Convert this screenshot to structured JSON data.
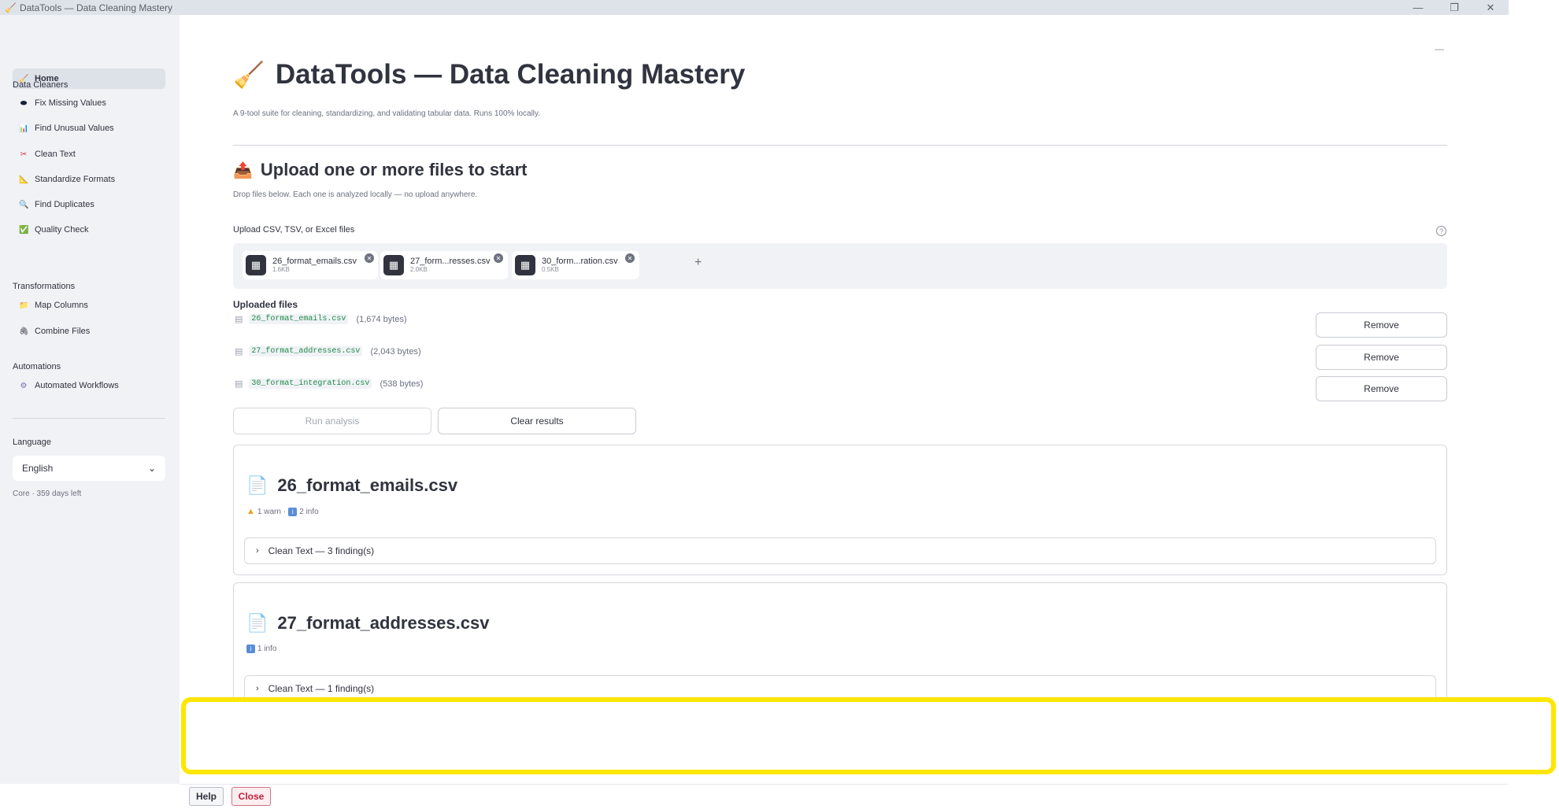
{
  "window": {
    "title": "DataTools — Data Cleaning Mastery",
    "icon": "broom-icon",
    "controls": {
      "minimize": "—",
      "restore": "❐",
      "close": "✕"
    }
  },
  "sidebar": {
    "home": {
      "label": "Home",
      "icon": "🧹"
    },
    "sections": [
      {
        "title": "Data Cleaners",
        "items": [
          {
            "label": "Fix Missing Values",
            "icon": "⬬"
          },
          {
            "label": "Find Unusual Values",
            "icon": "📊"
          },
          {
            "label": "Clean Text",
            "icon": "✂"
          },
          {
            "label": "Standardize Formats",
            "icon": "📐"
          },
          {
            "label": "Find Duplicates",
            "icon": "🔍"
          },
          {
            "label": "Quality Check",
            "icon": "✅"
          }
        ]
      },
      {
        "title": "Transformations",
        "items": [
          {
            "label": "Map Columns",
            "icon": "📁"
          },
          {
            "label": "Combine Files",
            "icon": "🖇"
          }
        ]
      },
      {
        "title": "Automations",
        "items": [
          {
            "label": "Automated Workflows",
            "icon": "⚙"
          }
        ]
      }
    ],
    "language_label": "Language",
    "language_value": "English",
    "license_text": "Core · 359 days left"
  },
  "main": {
    "title_icon": "🧹",
    "title": "DataTools — Data Cleaning Mastery",
    "subtitle": "A 9-tool suite for cleaning, standardizing, and validating tabular data. Runs 100% locally.",
    "upload_heading_icon": "📤",
    "upload_heading": "Upload one or more files to start",
    "upload_hint": "Drop files below. Each one is analyzed locally — no upload anywhere.",
    "uploader_label": "Upload CSV, TSV, or Excel files",
    "chips": [
      {
        "name": "26_format_emails.csv",
        "size": "1.6KB"
      },
      {
        "name": "27_form...resses.csv",
        "size": "2.0KB"
      },
      {
        "name": "30_form...ration.csv",
        "size": "0.5KB"
      }
    ],
    "add_more": "+",
    "uploaded_heading": "Uploaded files",
    "files": [
      {
        "name": "26_format_emails.csv",
        "bytes": "(1,674 bytes)",
        "remove": "Remove"
      },
      {
        "name": "27_format_addresses.csv",
        "bytes": "(2,043 bytes)",
        "remove": "Remove"
      },
      {
        "name": "30_format_integration.csv",
        "bytes": "(538 bytes)",
        "remove": "Remove"
      }
    ],
    "run_button": "Run analysis",
    "clear_button": "Clear results",
    "results": [
      {
        "file": "26_format_emails.csv",
        "warn": "1 warn",
        "sep": "·",
        "info": "2 info",
        "expander": "Clean Text — 3 finding(s)"
      },
      {
        "file": "27_format_addresses.csv",
        "info": "1 info",
        "expander": "Clean Text — 1 finding(s)"
      }
    ]
  },
  "bottom": {
    "help": "Help",
    "close": "Close"
  },
  "colors": {
    "sidebar_bg": "#f0f2f6",
    "highlight": "#ffe600",
    "close_accent": "#c0213c",
    "code_green": "#1f8a4a"
  }
}
